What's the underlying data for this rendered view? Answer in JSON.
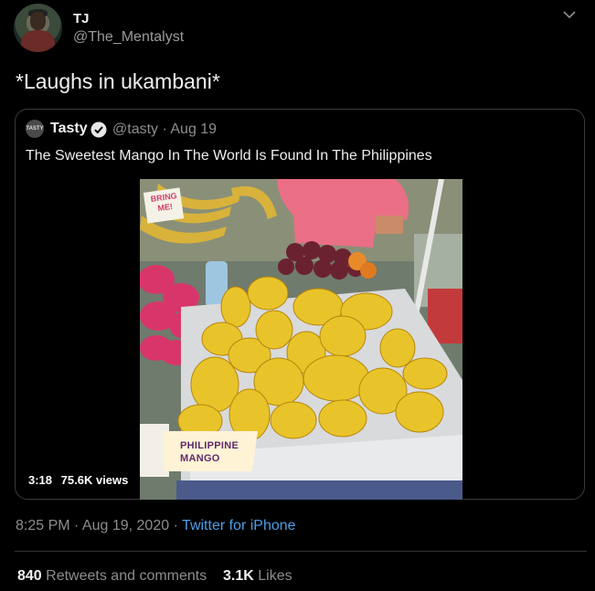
{
  "author": {
    "name": "TJ",
    "handle": "@The_Mentalyst"
  },
  "tweet_text": "*Laughs in ukambani*",
  "quoted": {
    "logo_text": "TASTY",
    "name": "Tasty",
    "meta": "@tasty · Aug 19",
    "text": "The Sweetest Mango In The World Is Found In The Philippines",
    "video": {
      "sign_top": "BRING ME!",
      "caption_line1": "PHILIPPINE",
      "caption_line2": "MANGO",
      "duration": "3:18",
      "views": "75.6K views"
    }
  },
  "footer": {
    "timestamp": "8:25 PM · Aug 19, 2020 · ",
    "client": "Twitter for iPhone",
    "retweets_count": "840",
    "retweets_label": "Retweets and comments",
    "likes_count": "3.1K",
    "likes_label": "Likes"
  },
  "colors": {
    "background": "#000000",
    "link": "#4a9fe8",
    "caption_bg": "#fff3d6",
    "caption_text": "#5e2a6b"
  }
}
